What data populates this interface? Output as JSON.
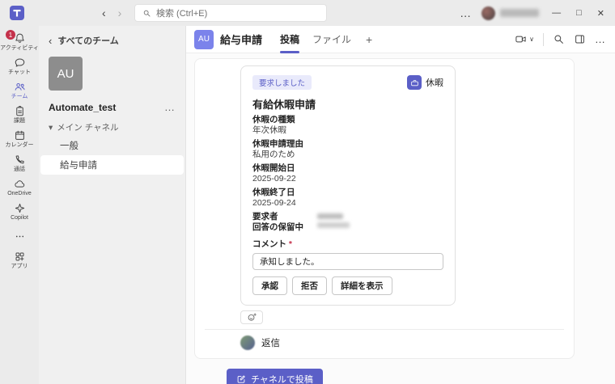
{
  "colors": {
    "accent": "#5b5fc7",
    "badge_bg": "#e9eafb",
    "alert_red": "#c4314b"
  },
  "titlebar": {
    "nav_back": "‹",
    "nav_forward": "›",
    "search_placeholder": "検索 (Ctrl+E)",
    "more": "…",
    "minimize": "—",
    "maximize": "□",
    "close": "✕"
  },
  "app_rail": {
    "items": [
      {
        "label": "アクティビティ",
        "icon": "bell",
        "badge": "1"
      },
      {
        "label": "チャット",
        "icon": "chat"
      },
      {
        "label": "チーム",
        "icon": "people",
        "active": true
      },
      {
        "label": "課題",
        "icon": "clipboard"
      },
      {
        "label": "カレンダー",
        "icon": "calendar"
      },
      {
        "label": "通話",
        "icon": "phone"
      },
      {
        "label": "OneDrive",
        "icon": "cloud"
      },
      {
        "label": "Copilot",
        "icon": "sparkle"
      },
      {
        "icon": "more"
      },
      {
        "label": "アプリ",
        "icon": "apps"
      }
    ]
  },
  "teams_panel": {
    "back_chevron": "‹",
    "back": "すべてのチーム",
    "team_initials": "AU",
    "team_name": "Automate_test",
    "team_more": "…",
    "section_caret": "▾",
    "section": "メイン チャネル",
    "channels": [
      {
        "name": "一般",
        "active": false
      },
      {
        "name": "給与申請",
        "active": true
      }
    ]
  },
  "channel_header": {
    "avatar_initials": "AU",
    "title": "給与申請",
    "tabs": [
      {
        "label": "投稿",
        "active": true
      },
      {
        "label": "ファイル",
        "active": false
      }
    ],
    "add_tab": "+",
    "video_chevron": "∨",
    "more": "…"
  },
  "card": {
    "status_badge": "要求しました",
    "category_label": "休暇",
    "title": "有給休暇申請",
    "fields": [
      {
        "label": "休暇の種類",
        "value": "年次休暇"
      },
      {
        "label": "休暇申請理由",
        "value": "私用のため"
      },
      {
        "label": "休暇開始日",
        "value": "2025-09-22"
      },
      {
        "label": "休暇終了日",
        "value": "2025-09-24"
      }
    ],
    "requester_label": "要求者",
    "pending_label": "回答の保留中",
    "comment_label": "コメント",
    "required_mark": "*",
    "comment_value": "承知しました。",
    "approve": "承認",
    "reject": "拒否",
    "details": "詳細を表示"
  },
  "thread": {
    "reply": "返信"
  },
  "composer": {
    "post_button": "チャネルで投稿"
  }
}
